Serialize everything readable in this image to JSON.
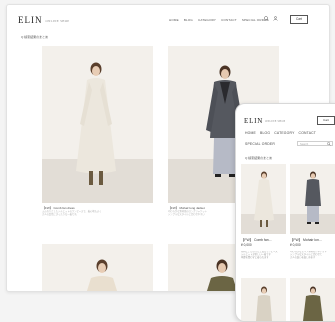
{
  "desktop": {
    "logo": "ELIN",
    "logo_sub": "ONLINE SHOP",
    "nav": [
      "HOME",
      "BLOG",
      "CATEGORY",
      "CONTACT",
      "SPECIAL ORDER"
    ],
    "cart_label": "Cart",
    "breadcrumb": "Q 検索結果のまとめ",
    "products": [
      {
        "title": "【FW】 Comb fan dress",
        "desc": [
          "ふんわりとしたシルエットのワンピースで、着心地もよく",
          "大人の女性にぴったりな一着です。"
        ]
      },
      {
        "title": "【FW】 Mohair long Jacket",
        "desc": [
          "やわらかな素材感のロングジャケット",
          "シンプルなスタイルに合わせやすい"
        ]
      }
    ]
  },
  "mobile": {
    "logo": "ELIN",
    "logo_sub": "ONLINE SHOP",
    "cart_label": "Cart",
    "nav_row1": [
      "HOME",
      "BLOG",
      "CATEGORY",
      "CONTACT"
    ],
    "nav_row2": "SPECIAL ORDER",
    "search_placeholder": "Search",
    "breadcrumb": "Q 検索結果のまとめ",
    "products": [
      {
        "title": "【FW】 Comb fan...",
        "price": "¥ 0,000",
        "desc": [
          "素材にこだわった上質なワンピース",
          "シルエットが美しい一着です",
          "季節を問わずに着られます"
        ]
      },
      {
        "title": "【FW】 Mohair lon...",
        "price": "¥ 0,000",
        "desc": [
          "やわらかなモヘア素材のジャケット",
          "シンプルなスタイルに合わせて",
          "大人の装いを楽しめます"
        ]
      }
    ]
  },
  "colors": {
    "accent": "#333333",
    "background": "#f4f4f4"
  }
}
